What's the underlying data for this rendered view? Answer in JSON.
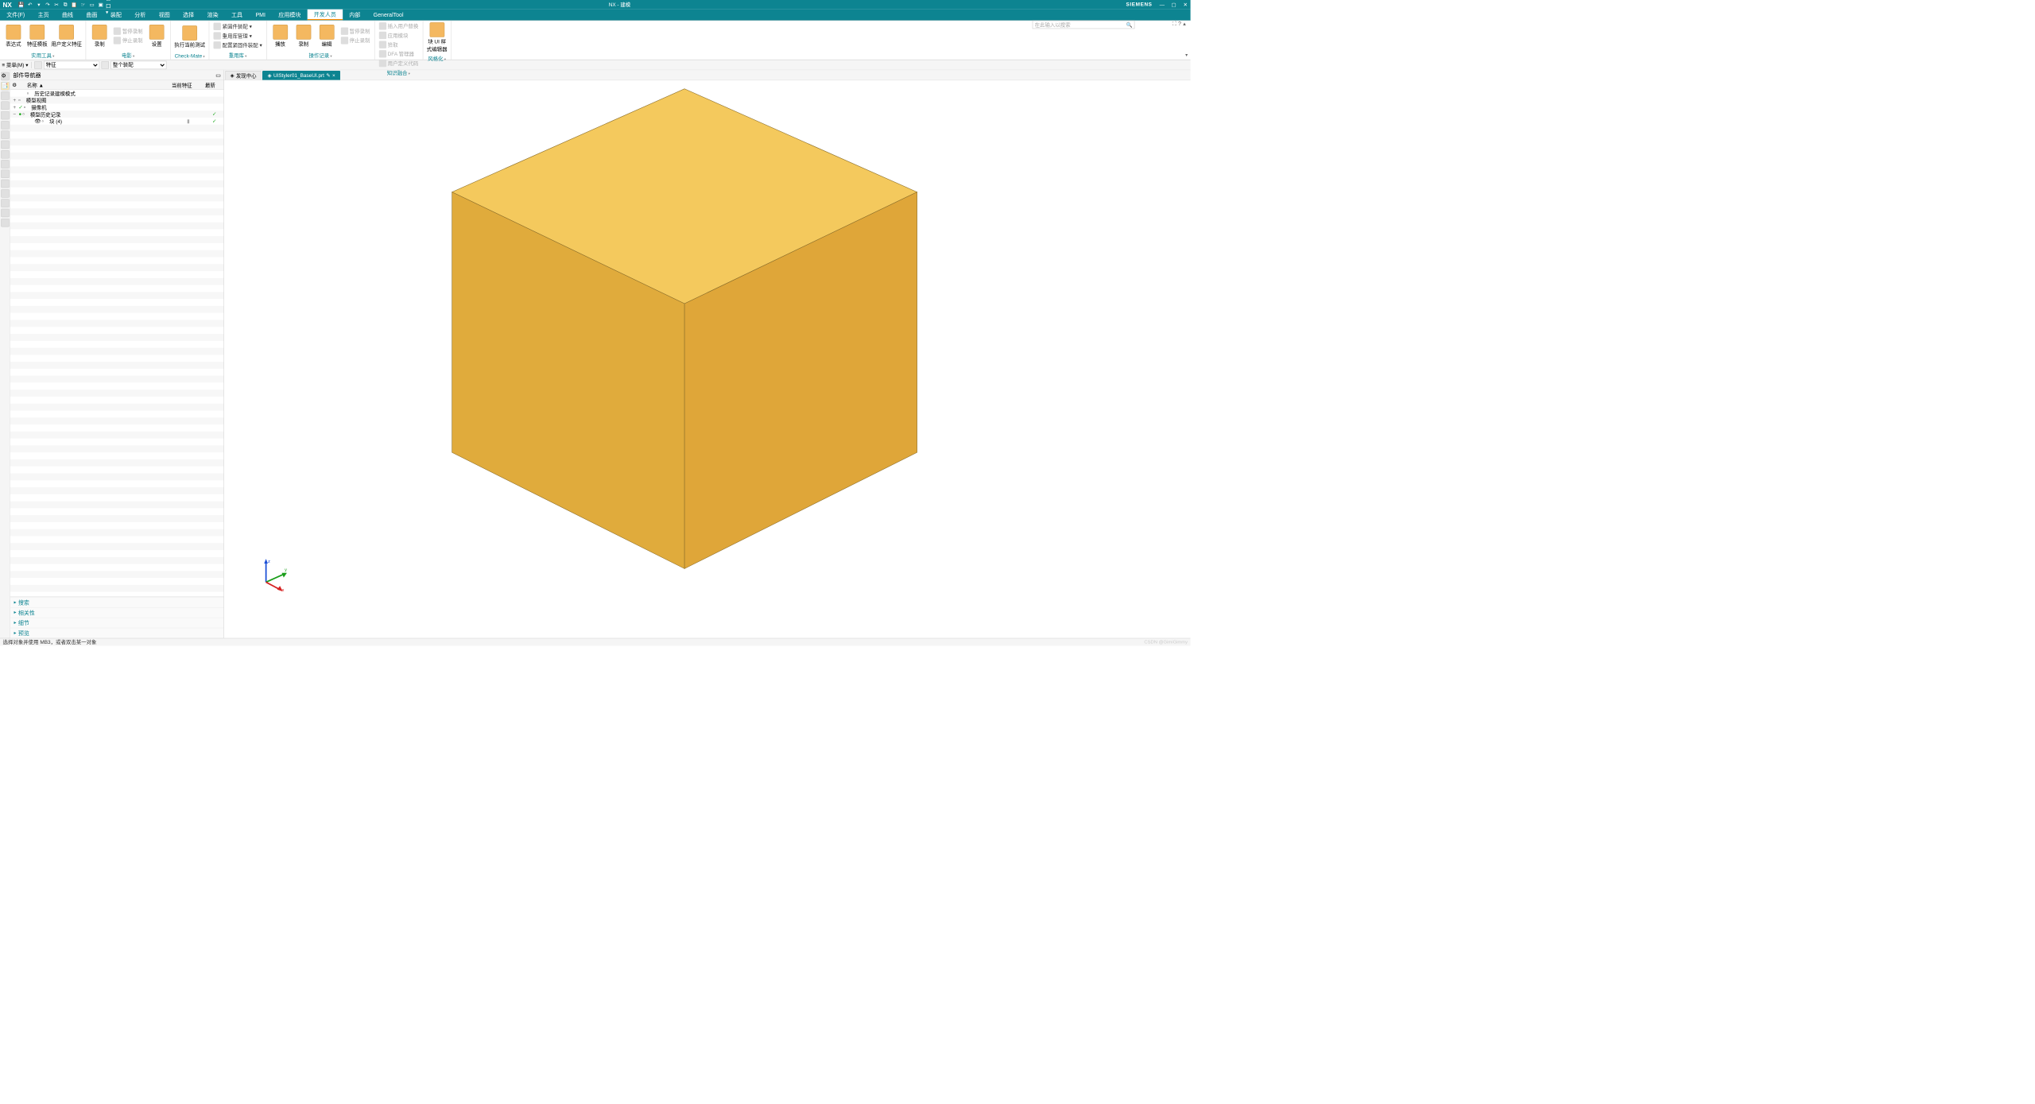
{
  "title_bar": {
    "logo": "NX",
    "title": "NX - 建模",
    "brand": "SIEMENS"
  },
  "menubar": {
    "items": [
      "文件(F)",
      "主页",
      "曲线",
      "曲面",
      "装配",
      "分析",
      "视图",
      "选择",
      "渲染",
      "工具",
      "PMI",
      "应用模块",
      "开发人员",
      "内部",
      "GeneralTool"
    ],
    "active_index": 12
  },
  "search": {
    "placeholder": "在此输入以搜索"
  },
  "ribbon": {
    "groups": [
      {
        "label": "实用工具",
        "big": [
          {
            "name": "表达式",
            "icon": "fx-icon"
          },
          {
            "name": "特征模板",
            "icon": "feature-template-icon"
          },
          {
            "name": "用户定义特征",
            "icon": "udf-icon"
          }
        ]
      },
      {
        "label": "电影",
        "big": [
          {
            "name": "录制",
            "icon": "record-icon"
          }
        ],
        "inline_disabled": [
          "暂停录制",
          "停止录制"
        ],
        "big2": [
          {
            "name": "设置",
            "icon": "settings-icon"
          }
        ]
      },
      {
        "label": "Check-Mate",
        "big": [
          {
            "name": "执行当前测试",
            "icon": "run-test-icon"
          }
        ]
      },
      {
        "label": "重用库",
        "rows": [
          {
            "icon": "fasten-icon",
            "label": "紧固件装配",
            "drop": true
          },
          {
            "icon": "reuse-icon",
            "label": "重用库管理",
            "drop": true
          },
          {
            "icon": "config-icon",
            "label": "配置紧固件装配",
            "drop": true
          }
        ]
      },
      {
        "label": "操作记录",
        "big": [
          {
            "name": "播放",
            "icon": "play-icon"
          },
          {
            "name": "录制",
            "icon": "record2-icon"
          }
        ],
        "inline_disabled2": [
          "暂停录制",
          "停止录制"
        ],
        "big2": [
          {
            "name": "编辑",
            "icon": "edit-icon"
          }
        ]
      },
      {
        "label": "知识融合",
        "rows": [
          {
            "icon": "import-ua-icon",
            "label": "插入用户替换",
            "disabled": true
          },
          {
            "icon": "app-mod-icon",
            "label": "应用模块",
            "disabled": true
          },
          {
            "icon": "pick-icon",
            "label": "拾取",
            "disabled": true
          },
          {
            "icon": "dfa-icon",
            "label": "DFA 管理器",
            "disabled": true
          },
          {
            "icon": "user-code-icon",
            "label": "用户定义代码",
            "disabled": true
          }
        ]
      },
      {
        "label": "风格化",
        "big": [
          {
            "name": "块 UI 样\n式编辑器",
            "icon": "block-ui-icon"
          }
        ]
      }
    ]
  },
  "selbar": {
    "menu_label": "菜单(M)",
    "filter1": "特征",
    "filter2": "整个装配"
  },
  "nav": {
    "title": "部件导航器",
    "cols": [
      "名称  ▲",
      "当前特征",
      "最新"
    ],
    "rows": [
      {
        "lvl": 1,
        "exp": "",
        "icon": "clock-icon",
        "txt": "历史记录建模模式",
        "cf": "",
        "chk": ""
      },
      {
        "lvl": 0,
        "exp": "+",
        "icon": "modelview-icon",
        "txt": "模型视图",
        "cf": "",
        "chk": ""
      },
      {
        "lvl": 0,
        "exp": "+",
        "icon": "camera-icon",
        "txt": "摄像机",
        "cf": "",
        "chk": "",
        "check": true
      },
      {
        "lvl": 0,
        "exp": "−",
        "icon": "history-icon",
        "txt": "模型历史记录",
        "cf": "",
        "chk": "✓",
        "green_dot": true
      },
      {
        "lvl": 2,
        "exp": "",
        "icon": "block-icon",
        "txt": "块 (4)",
        "cf": "bar",
        "chk": "✓",
        "eye": true
      }
    ],
    "sections": [
      "搜索",
      "相关性",
      "细节",
      "预览"
    ]
  },
  "tabs": {
    "items": [
      {
        "label": "发现中心",
        "icon": "discover-icon",
        "active": false
      },
      {
        "label": "UIStyler01_BaseUI.prt",
        "icon": "part-icon",
        "active": true,
        "mod": "✎",
        "close": "×"
      }
    ]
  },
  "triad_labels": {
    "x": "x",
    "y": "y",
    "z": "z"
  },
  "statusbar": {
    "msg": "选择对象并使用 MB3，或者双击某一对象",
    "watermark": "CSDN @GimiGimmy"
  }
}
